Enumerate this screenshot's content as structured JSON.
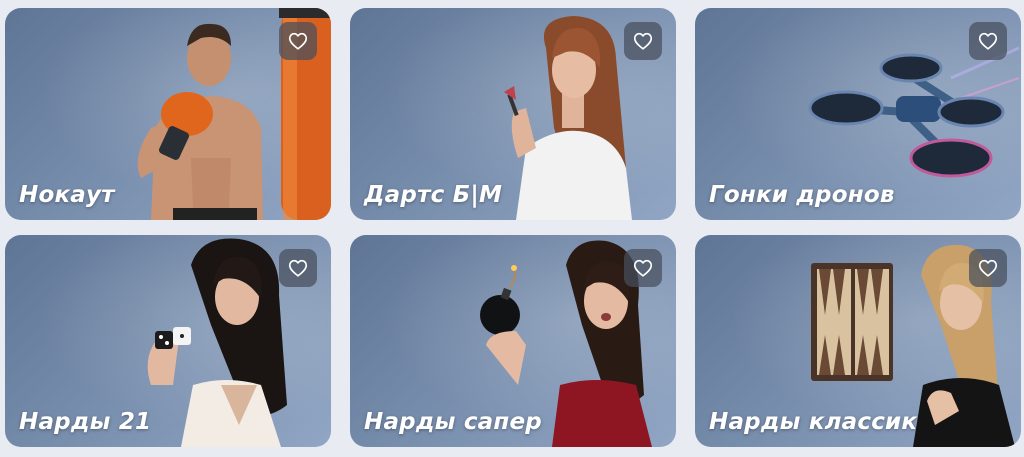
{
  "games": [
    {
      "title": "Нокаут",
      "image": "boxer-with-punching-bag",
      "icon": "heart-icon"
    },
    {
      "title": "Дартс Б|М",
      "image": "woman-holding-dart",
      "icon": "heart-icon"
    },
    {
      "title": "Гонки дронов",
      "image": "quadcopter-drone",
      "icon": "heart-icon"
    },
    {
      "title": "Нарды 21",
      "image": "woman-holding-dice",
      "icon": "heart-icon"
    },
    {
      "title": "Нарды сапер",
      "image": "woman-holding-bomb",
      "icon": "heart-icon"
    },
    {
      "title": "Нарды классик",
      "image": "woman-with-backgammon-board",
      "icon": "heart-icon"
    }
  ],
  "colors": {
    "page_background": "#e9ebf3",
    "card_background": "#6f86a6",
    "favorite_button": "#464e5c",
    "title_text": "#ffffff"
  }
}
